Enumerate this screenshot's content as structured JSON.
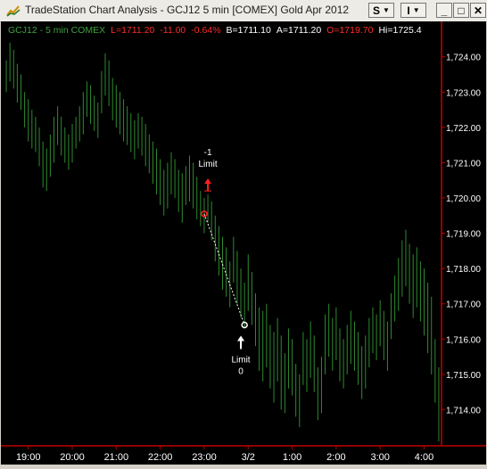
{
  "window": {
    "title": "TradeStation Chart Analysis - GCJ12 5 min [COMEX] Gold Apr 2012",
    "icon": "chart-app-icon",
    "buttons": {
      "s_label": "S",
      "i_label": "I",
      "minimize": "_",
      "maximize": "□",
      "close": "✕"
    }
  },
  "infobar": {
    "symbol": "GCJ12 - 5 min  COMEX",
    "low": "L=1711.20",
    "change": "-11.00",
    "change_pct": "-0.64%",
    "bid": "B=1711.10",
    "ask": "A=1711.20",
    "open": "O=1719.70",
    "high": "Hi=1725.4",
    "colors": {
      "symbol": "#3fa23f",
      "red": "#ff2a2a",
      "white": "#ffffff"
    }
  },
  "colors": {
    "background": "#000000",
    "bars": "#2f8a2f",
    "axis": "#c00000",
    "text": "#ffffff",
    "trade_line": "#ffffff",
    "entry": "#ff2020",
    "exit": "#ffffff"
  },
  "chart_data": {
    "type": "ohlc",
    "y_range": [
      1713,
      1724.6
    ],
    "y_ticks": [
      "1,714.00",
      "1,715.00",
      "1,716.00",
      "1,717.00",
      "1,718.00",
      "1,719.00",
      "1,720.00",
      "1,721.00",
      "1,722.00",
      "1,723.00",
      "1,724.00"
    ],
    "y_tick_values": [
      1714,
      1715,
      1716,
      1717,
      1718,
      1719,
      1720,
      1721,
      1722,
      1723,
      1724
    ],
    "x_ticks": [
      "19:00",
      "20:00",
      "21:00",
      "22:00",
      "23:00",
      "3/2",
      "1:00",
      "2:00",
      "3:00",
      "4:00"
    ],
    "x_tick_bars": [
      6,
      18,
      30,
      42,
      54,
      66,
      78,
      90,
      102,
      114
    ],
    "bars": [
      {
        "h": 1723.9,
        "l": 1723.0
      },
      {
        "h": 1724.4,
        "l": 1723.3
      },
      {
        "h": 1724.2,
        "l": 1723.1
      },
      {
        "h": 1723.8,
        "l": 1722.7
      },
      {
        "h": 1723.5,
        "l": 1722.5
      },
      {
        "h": 1723.0,
        "l": 1722.0
      },
      {
        "h": 1722.8,
        "l": 1721.6
      },
      {
        "h": 1722.5,
        "l": 1721.4
      },
      {
        "h": 1722.3,
        "l": 1721.3
      },
      {
        "h": 1722.0,
        "l": 1720.9
      },
      {
        "h": 1721.6,
        "l": 1720.3
      },
      {
        "h": 1721.4,
        "l": 1720.2
      },
      {
        "h": 1721.8,
        "l": 1720.6
      },
      {
        "h": 1722.3,
        "l": 1721.0
      },
      {
        "h": 1722.6,
        "l": 1721.5
      },
      {
        "h": 1722.3,
        "l": 1721.2
      },
      {
        "h": 1722.0,
        "l": 1721.0
      },
      {
        "h": 1721.8,
        "l": 1720.8
      },
      {
        "h": 1722.1,
        "l": 1721.0
      },
      {
        "h": 1722.3,
        "l": 1721.4
      },
      {
        "h": 1722.6,
        "l": 1721.6
      },
      {
        "h": 1723.0,
        "l": 1721.8
      },
      {
        "h": 1723.3,
        "l": 1722.3
      },
      {
        "h": 1723.2,
        "l": 1722.1
      },
      {
        "h": 1722.9,
        "l": 1721.9
      },
      {
        "h": 1722.7,
        "l": 1721.7
      },
      {
        "h": 1723.6,
        "l": 1722.4
      },
      {
        "h": 1724.1,
        "l": 1722.9
      },
      {
        "h": 1723.9,
        "l": 1722.6
      },
      {
        "h": 1723.4,
        "l": 1722.2
      },
      {
        "h": 1723.2,
        "l": 1722.0
      },
      {
        "h": 1723.0,
        "l": 1721.8
      },
      {
        "h": 1722.8,
        "l": 1721.6
      },
      {
        "h": 1722.6,
        "l": 1721.5
      },
      {
        "h": 1722.4,
        "l": 1721.3
      },
      {
        "h": 1722.2,
        "l": 1721.1
      },
      {
        "h": 1722.4,
        "l": 1721.4
      },
      {
        "h": 1722.3,
        "l": 1721.2
      },
      {
        "h": 1722.1,
        "l": 1720.9
      },
      {
        "h": 1721.8,
        "l": 1720.7
      },
      {
        "h": 1721.6,
        "l": 1720.4
      },
      {
        "h": 1721.4,
        "l": 1720.1
      },
      {
        "h": 1721.1,
        "l": 1719.8
      },
      {
        "h": 1720.8,
        "l": 1719.5
      },
      {
        "h": 1721.0,
        "l": 1719.7
      },
      {
        "h": 1721.3,
        "l": 1720.1
      },
      {
        "h": 1721.1,
        "l": 1720.0
      },
      {
        "h": 1720.8,
        "l": 1719.6
      },
      {
        "h": 1720.7,
        "l": 1719.3
      },
      {
        "h": 1720.9,
        "l": 1719.8
      },
      {
        "h": 1721.2,
        "l": 1719.9
      },
      {
        "h": 1721.0,
        "l": 1719.7
      },
      {
        "h": 1720.6,
        "l": 1719.4
      },
      {
        "h": 1720.2,
        "l": 1719.2
      },
      {
        "h": 1720.0,
        "l": 1719.0
      },
      {
        "h": 1720.1,
        "l": 1719.3
      },
      {
        "h": 1719.9,
        "l": 1718.8
      },
      {
        "h": 1719.5,
        "l": 1718.2
      },
      {
        "h": 1719.2,
        "l": 1717.8
      },
      {
        "h": 1718.9,
        "l": 1717.4
      },
      {
        "h": 1718.6,
        "l": 1717.2
      },
      {
        "h": 1718.2,
        "l": 1716.9
      },
      {
        "h": 1718.9,
        "l": 1717.6
      },
      {
        "h": 1718.5,
        "l": 1717.0
      },
      {
        "h": 1718.0,
        "l": 1716.6
      },
      {
        "h": 1717.6,
        "l": 1716.3
      },
      {
        "h": 1718.4,
        "l": 1716.8
      },
      {
        "h": 1717.9,
        "l": 1716.4
      },
      {
        "h": 1717.3,
        "l": 1715.8
      },
      {
        "h": 1716.9,
        "l": 1715.1
      },
      {
        "h": 1716.8,
        "l": 1714.8
      },
      {
        "h": 1717.0,
        "l": 1715.2
      },
      {
        "h": 1716.4,
        "l": 1714.6
      },
      {
        "h": 1716.2,
        "l": 1714.2
      },
      {
        "h": 1716.6,
        "l": 1714.8
      },
      {
        "h": 1716.1,
        "l": 1714.0
      },
      {
        "h": 1715.6,
        "l": 1713.9
      },
      {
        "h": 1716.3,
        "l": 1714.6
      },
      {
        "h": 1716.0,
        "l": 1714.4
      },
      {
        "h": 1715.3,
        "l": 1713.8
      },
      {
        "h": 1715.0,
        "l": 1713.5
      },
      {
        "h": 1716.2,
        "l": 1714.7
      },
      {
        "h": 1716.0,
        "l": 1714.5
      },
      {
        "h": 1716.5,
        "l": 1714.9
      },
      {
        "h": 1716.1,
        "l": 1714.5
      },
      {
        "h": 1715.2,
        "l": 1713.7
      },
      {
        "h": 1715.5,
        "l": 1713.9
      },
      {
        "h": 1716.7,
        "l": 1715.0
      },
      {
        "h": 1717.0,
        "l": 1715.5
      },
      {
        "h": 1716.6,
        "l": 1715.1
      },
      {
        "h": 1716.9,
        "l": 1715.4
      },
      {
        "h": 1716.3,
        "l": 1714.8
      },
      {
        "h": 1716.0,
        "l": 1714.6
      },
      {
        "h": 1716.4,
        "l": 1715.0
      },
      {
        "h": 1716.8,
        "l": 1715.3
      },
      {
        "h": 1716.5,
        "l": 1715.1
      },
      {
        "h": 1716.2,
        "l": 1714.7
      },
      {
        "h": 1715.8,
        "l": 1714.3
      },
      {
        "h": 1716.1,
        "l": 1714.6
      },
      {
        "h": 1716.6,
        "l": 1715.2
      },
      {
        "h": 1716.9,
        "l": 1715.6
      },
      {
        "h": 1716.7,
        "l": 1715.4
      },
      {
        "h": 1717.1,
        "l": 1715.8
      },
      {
        "h": 1716.8,
        "l": 1715.4
      },
      {
        "h": 1716.5,
        "l": 1715.1
      },
      {
        "h": 1717.3,
        "l": 1716.0
      },
      {
        "h": 1717.8,
        "l": 1716.5
      },
      {
        "h": 1718.3,
        "l": 1716.8
      },
      {
        "h": 1718.8,
        "l": 1717.2
      },
      {
        "h": 1719.1,
        "l": 1717.5
      },
      {
        "h": 1718.7,
        "l": 1717.0
      },
      {
        "h": 1718.4,
        "l": 1716.6
      },
      {
        "h": 1718.6,
        "l": 1716.9
      },
      {
        "h": 1718.2,
        "l": 1716.5
      },
      {
        "h": 1718.0,
        "l": 1716.1
      },
      {
        "h": 1717.6,
        "l": 1715.6
      },
      {
        "h": 1717.2,
        "l": 1715.0
      },
      {
        "h": 1716.0,
        "l": 1714.2
      },
      {
        "h": 1715.2,
        "l": 1713.1
      }
    ],
    "entry": {
      "label_qty": "-1",
      "label_type": "Limit",
      "bar": 54,
      "price": 1719.55,
      "marker_price": 1720.3
    },
    "exit": {
      "label_type": "Limit",
      "label_qty": "0",
      "bar": 65,
      "price": 1716.4
    }
  }
}
